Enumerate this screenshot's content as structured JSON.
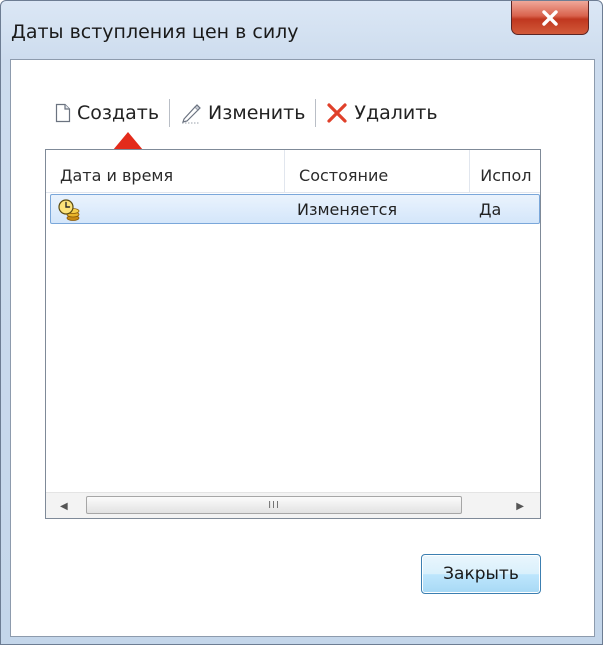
{
  "window": {
    "title": "Даты вступления цен в силу"
  },
  "toolbar": {
    "create_label": "Создать",
    "edit_label": "Изменить",
    "delete_label": "Удалить"
  },
  "list": {
    "columns": [
      "Дата и время",
      "Состояние",
      "Испол"
    ],
    "rows": [
      {
        "date": "",
        "status": "Изменяется",
        "used": "Да"
      }
    ],
    "scrollbar_grip": "III"
  },
  "footer": {
    "close_label": "Закрыть"
  },
  "colors": {
    "close_button": "#c0371f",
    "selection": "#d4e6fa",
    "arrow": "#e32b1b",
    "delete_icon": "#e0402a"
  },
  "icons": {
    "titlebar_close": "close-icon",
    "create": "document-icon",
    "edit": "pencil-icon",
    "delete": "delete-x-icon",
    "row": "clock-coins-icon",
    "annotation": "red-arrow-icon"
  }
}
